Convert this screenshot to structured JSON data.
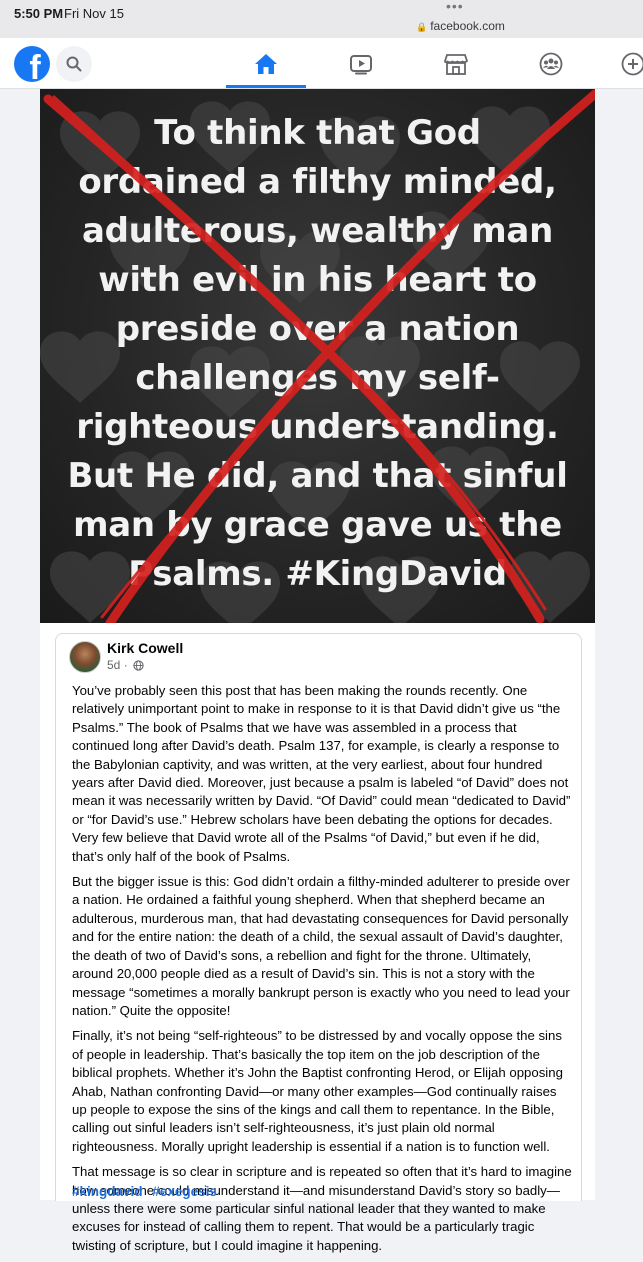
{
  "status_bar": {
    "time": "5:50 PM",
    "date": "Fri Nov 15",
    "url": "facebook.com",
    "more_dots": "•••"
  },
  "nav": {
    "logo_letter": "f",
    "icons": [
      "facebook-logo",
      "search-icon",
      "home-icon",
      "video-icon",
      "marketplace-icon",
      "groups-icon",
      "add-icon"
    ],
    "active_tab": "home",
    "accent_color": "#1877f2"
  },
  "post": {
    "image_text_lines": [
      "To think that God",
      "ordained a filthy minded,",
      "adulterous, wealthy man",
      "with evil in his heart to",
      "preside over a nation",
      "challenges my self-",
      "righteous understanding.",
      "But He did, and that sinful",
      "man by grace gave us the",
      "Psalms. #KingDavid"
    ],
    "image_overlay": "red-x-mark",
    "author": "Kirk Cowell",
    "timestamp": "5d",
    "audience_icon": "globe-icon",
    "paragraphs": [
      "You’ve probably seen this post that has been making the rounds recently. One relatively unimportant point to make in response to it is that David didn’t give us “the Psalms.” The book of Psalms that we have was assembled in a process that continued long after David’s death. Psalm 137, for example, is clearly a response to the Babylonian captivity, and was written, at the very earliest, about four hundred years after David died. Moreover, just because a psalm is labeled “of David” does not mean it was necessarily written by David. “Of David” could mean “dedicated to David” or “for David’s use.” Hebrew scholars have been debating the options for decades. Very few believe that David wrote all of the Psalms “of David,” but even if he did, that’s only half of the book of Psalms.",
      "But the bigger issue is this: God didn’t ordain a filthy-minded adulterer to preside over a nation. He ordained a faithful young shepherd. When that shepherd became an adulterous, murderous man, that had devastating consequences for David personally and for the entire nation: the death of a child, the sexual assault of David’s daughter, the death of two of David’s sons, a rebellion and fight for the throne. Ultimately, around 20,000 people died as a result of David’s sin. This is not a story with the message “sometimes a morally bankrupt person is exactly who you need to lead your nation.” Quite the opposite!",
      "Finally, it’s not being “self-righteous” to be distressed by and vocally oppose the sins of people in leadership. That’s basically the top item on the job description of the biblical prophets. Whether it’s John the Baptist confronting Herod, or Elijah opposing Ahab, Nathan confronting David—or many other examples—God continually raises up people to expose the sins of the kings and call them to repentance.  In the Bible, calling out sinful leaders isn’t self-righteousness, it’s just plain old normal righteousness. Morally upright leadership is essential if a nation is to function well.",
      "That message is so clear in scripture and is repeated so often that it’s hard to imagine how someone could misunderstand it—and misunderstand David’s story so badly—unless there were some particular sinful national leader that they wanted to make excuses for instead of calling them to repent. That would be a particularly tragic twisting of scripture, but I could imagine it happening."
    ],
    "hashtags": [
      "#kingdavid",
      "#exegesis"
    ],
    "hashtag_color": "#216fdb"
  }
}
